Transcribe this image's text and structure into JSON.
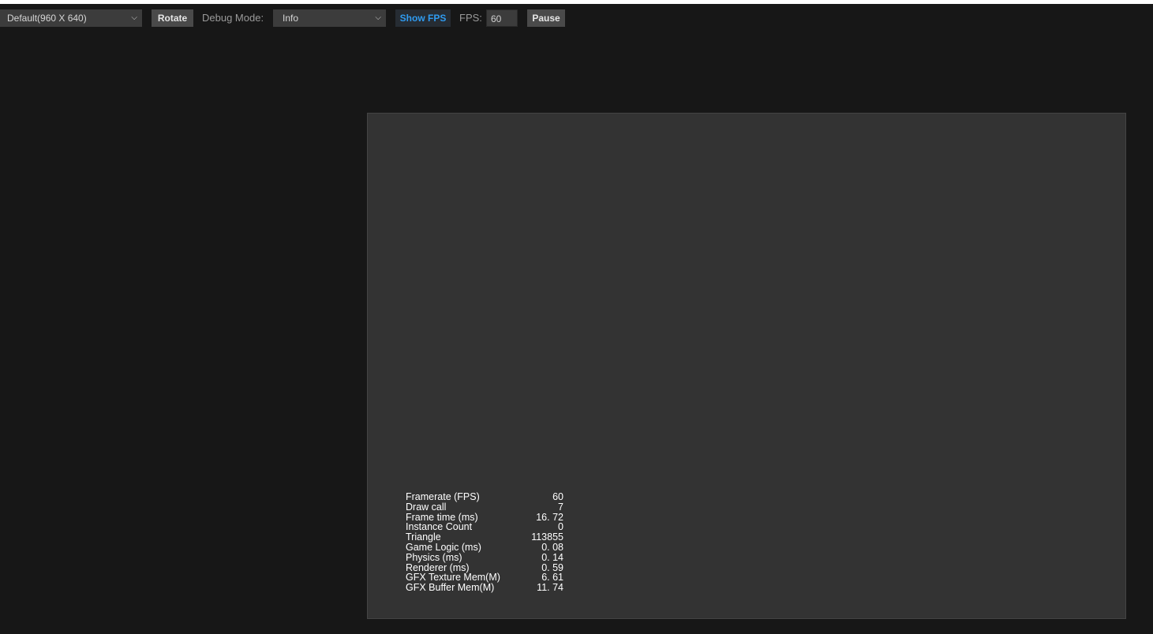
{
  "toolbar": {
    "resolution_select": "Default(960 X 640)",
    "rotate_label": "Rotate",
    "debug_mode_label": "Debug Mode:",
    "debug_mode_select": "Info",
    "show_fps_label": "Show FPS",
    "fps_label": "FPS:",
    "fps_value": "60",
    "pause_label": "Pause"
  },
  "stats": [
    {
      "name": "Framerate (FPS)",
      "value": "60"
    },
    {
      "name": "Draw call",
      "value": "7"
    },
    {
      "name": "Frame time (ms)",
      "value": "16. 72"
    },
    {
      "name": "Instance Count",
      "value": "0"
    },
    {
      "name": "Triangle",
      "value": "113855"
    },
    {
      "name": "Game Logic (ms)",
      "value": "0. 08"
    },
    {
      "name": "Physics (ms)",
      "value": "0. 14"
    },
    {
      "name": "Renderer (ms)",
      "value": "0. 59"
    },
    {
      "name": "GFX Texture Mem(M)",
      "value": "6. 61"
    },
    {
      "name": "GFX Buffer Mem(M)",
      "value": "11. 74"
    }
  ],
  "colors": {
    "background": "#171717",
    "canvas": "#333333",
    "accent": "#2f9bf0"
  }
}
